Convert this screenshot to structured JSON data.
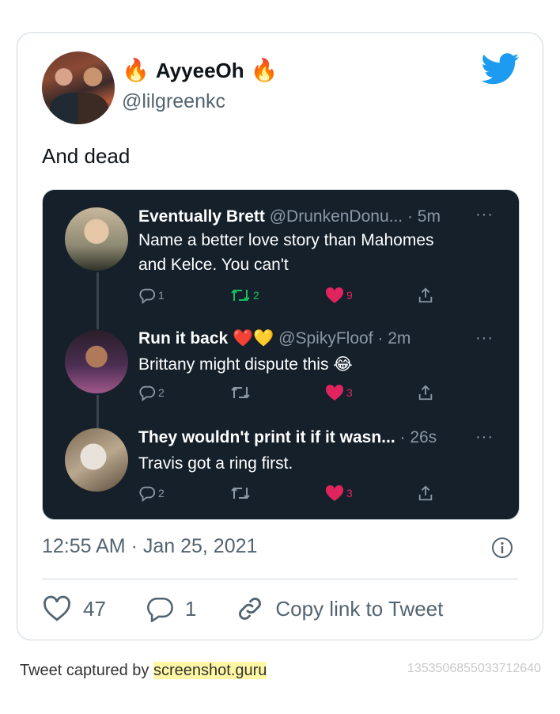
{
  "tweet": {
    "display_name": "AyyeeOh",
    "name_emoji": "🔥",
    "handle": "@lilgreenkc",
    "text": "And dead",
    "timestamp": "12:55 AM · Jan 25, 2021",
    "likes": "47",
    "replies": "1",
    "copy_link_label": "Copy link to Tweet",
    "brand_color": "#1d9bf0"
  },
  "screenshot": {
    "theme": "dark",
    "tweets": [
      {
        "name": "Eventually Brett",
        "handle": "@DrunkenDonu...",
        "time": "· 5m",
        "more": "···",
        "text_line1": "Name a better love story than Mahomes",
        "text_line2": "and Kelce. You can't",
        "replies": "1",
        "retweets": "2",
        "likes": "9"
      },
      {
        "name": "Run it back",
        "name_emoji": "❤️💛",
        "handle": "@SpikyFloof",
        "time": "· 2m",
        "more": "···",
        "text": "Brittany might dispute this",
        "text_emoji": "😂",
        "replies": "2",
        "retweets": "",
        "likes": "3"
      },
      {
        "name": "They wouldn't print it if it wasn...",
        "handle": "",
        "time": "· 26s",
        "more": "···",
        "text": "Travis got a ring first.",
        "replies": "2",
        "retweets": "",
        "likes": "3"
      }
    ]
  },
  "footer": {
    "captured_by": "Tweet captured by",
    "site": "screenshot.guru",
    "tweet_id": "1353506855033712640"
  }
}
